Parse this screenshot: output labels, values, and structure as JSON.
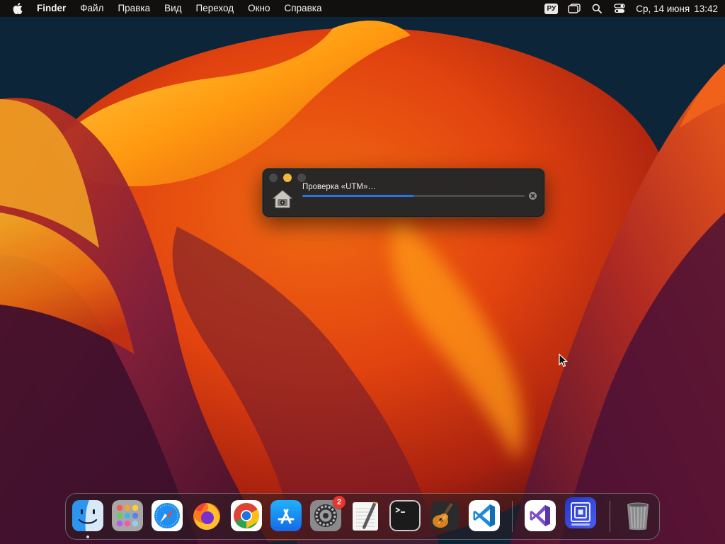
{
  "menubar": {
    "apple_icon": "apple-logo-icon",
    "app_name": "Finder",
    "menus": [
      "Файл",
      "Правка",
      "Вид",
      "Переход",
      "Окно",
      "Справка"
    ],
    "input_source": "РУ",
    "date": "Ср, 14 июня",
    "time": "13:42"
  },
  "progress_window": {
    "title": "Проверка «UTM»…",
    "progress": 0.5,
    "icon": "house-lock-icon"
  },
  "dock": {
    "apps": [
      {
        "name": "Finder",
        "running": true
      },
      {
        "name": "Launchpad"
      },
      {
        "name": "Safari"
      },
      {
        "name": "Firefox"
      },
      {
        "name": "Google Chrome"
      },
      {
        "name": "App Store"
      },
      {
        "name": "System Settings",
        "badge": "2"
      },
      {
        "name": "TextEdit"
      },
      {
        "name": "Terminal"
      },
      {
        "name": "GarageBand"
      },
      {
        "name": "Visual Studio Code"
      },
      {
        "name": "Visual Studio"
      },
      {
        "name": "UTM"
      },
      {
        "name": "Trash"
      }
    ]
  },
  "colors": {
    "accent_blue": "#2a73e6",
    "minimize_yellow": "#f3b93b",
    "badge_red": "#e8352d"
  }
}
